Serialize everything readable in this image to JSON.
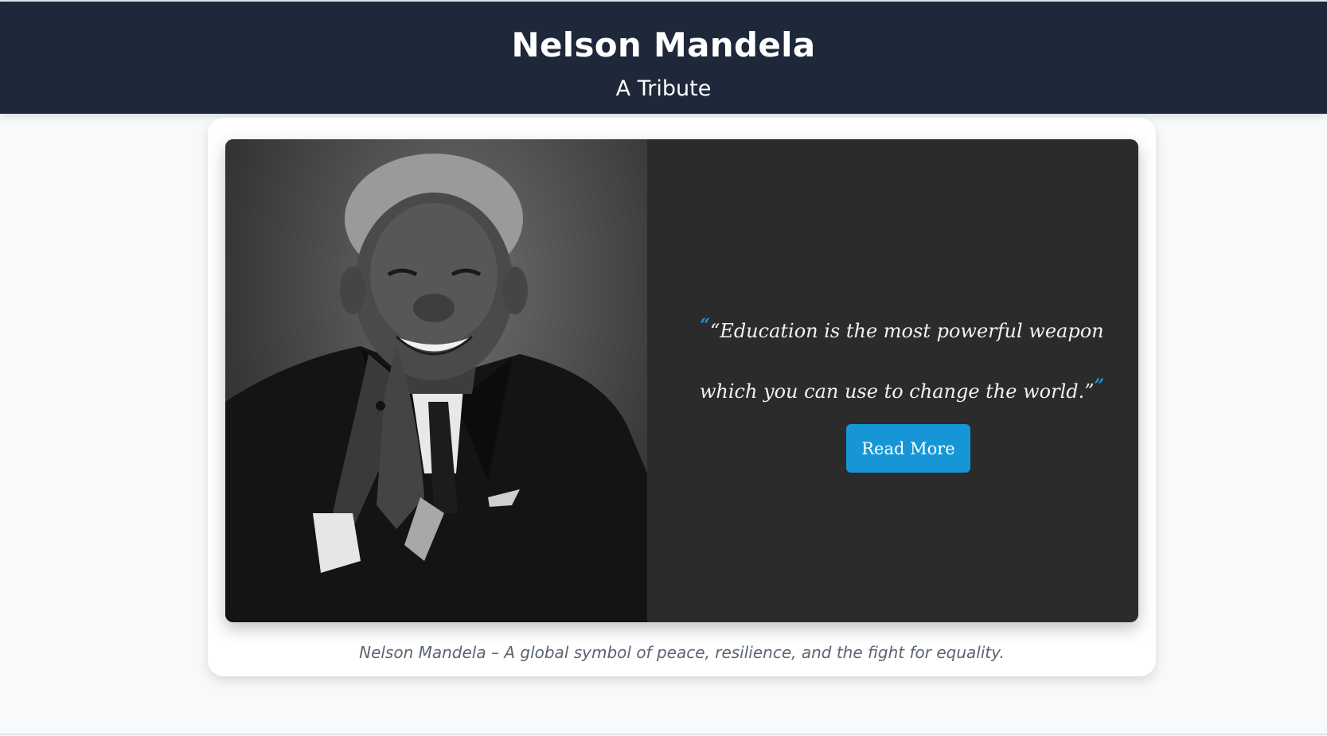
{
  "header": {
    "title": "Nelson Mandela",
    "subtitle": "A Tribute"
  },
  "feature": {
    "portrait_alt": "Nelson Mandela",
    "quote": "“Education is the most powerful weapon which you can use to change the world.”",
    "open_quote_mark": "“",
    "close_quote_mark": "”",
    "read_more_label": "Read More"
  },
  "caption": "Nelson Mandela – A global symbol of peace, resilience, and the fight for equality.",
  "colors": {
    "header_bg": "#1e283a",
    "panel_bg": "#2b2b2b",
    "accent": "#1696d6",
    "page_bg": "#f7f9fb"
  }
}
